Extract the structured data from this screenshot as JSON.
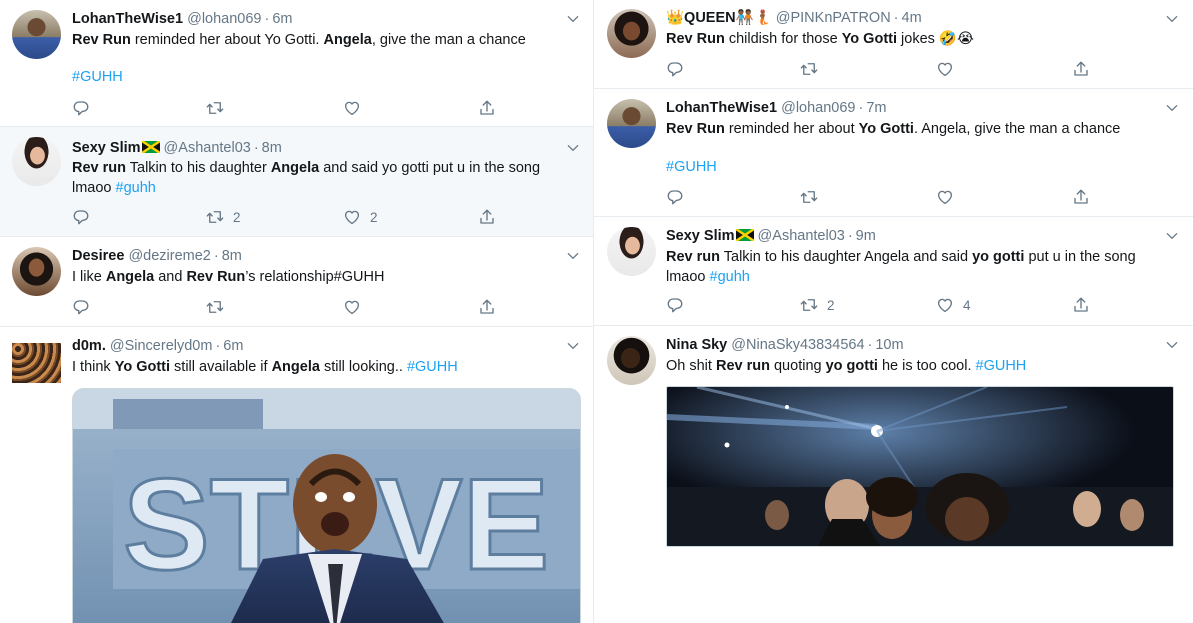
{
  "left": {
    "tweets": [
      {
        "name": "LohanTheWise1",
        "handle": "@lohan069",
        "time": "6m",
        "line1_a": "Rev Run",
        "line1_b": " reminded her about Yo Gotti. ",
        "line1_c": "Angela",
        "line1_d": ", give the man a chance",
        "hashtag": "#GUHH"
      },
      {
        "name": "Sexy Slim",
        "handle": "@Ashantel03",
        "time": "8m",
        "line1_a": "Rev run",
        "line1_b": " Talkin to his daughter ",
        "line1_c": "Angela",
        "line1_d": " and said yo gotti put u in the song",
        "line2": "lmaoo ",
        "hashtag": "#guhh",
        "retweets": "2",
        "likes": "2"
      },
      {
        "name": "Desiree",
        "handle": "@dezireme2",
        "time": "8m",
        "line1_a": "I like ",
        "line1_b": "Angela",
        "line1_c": " and ",
        "line1_d": "Rev Run",
        "line1_e": "’s relationship#GUHH"
      },
      {
        "name": "d0m.",
        "handle": "@Sincerelyd0m",
        "time": "6m",
        "line1_a": "I think ",
        "line1_b": "Yo Gotti",
        "line1_c": " still available if ",
        "line1_d": "Angela",
        "line1_e": " still looking.. ",
        "hashtag": "#GUHH"
      }
    ]
  },
  "right": {
    "tweets": [
      {
        "name": "👑QUEEN🧑🏾‍🤝‍🧑🏾🧜🏾",
        "handle": "@PINKnPATRON",
        "time": "4m",
        "line1_a": "Rev Run",
        "line1_b": " childish for those ",
        "line1_c": "Yo Gotti",
        "line1_d": " jokes 🤣😭"
      },
      {
        "name": "LohanTheWise1",
        "handle": "@lohan069",
        "time": "7m",
        "line1_a": "Rev Run",
        "line1_b": " reminded her about ",
        "line1_c": "Yo Gotti",
        "line1_d": ". Angela, give the man a chance",
        "hashtag": "#GUHH"
      },
      {
        "name": "Sexy Slim",
        "handle": "@Ashantel03",
        "time": "9m",
        "line1_a": "Rev run",
        "line1_b": " Talkin to his daughter Angela and said ",
        "line1_c": "yo gotti",
        "line1_d": " put u in the song",
        "line2": "lmaoo ",
        "hashtag": "#guhh",
        "retweets": "2",
        "likes": "4"
      },
      {
        "name": "Nina Sky",
        "handle": "@NinaSky43834564",
        "time": "10m",
        "line1_a": "Oh shit ",
        "line1_b": "Rev run",
        "line1_c": " quoting ",
        "line1_d": "yo gotti",
        "line1_e": " he is too cool.  ",
        "hashtag": "#GUHH"
      }
    ]
  },
  "colors": {
    "link": "#1da1f2",
    "muted": "#657786",
    "border": "#e6ecf0",
    "highlight_bg": "#f5f8fa"
  },
  "icons": [
    "reply-icon",
    "retweet-icon",
    "like-icon",
    "share-icon",
    "chevron-down-icon",
    "jamaica-flag-icon"
  ]
}
